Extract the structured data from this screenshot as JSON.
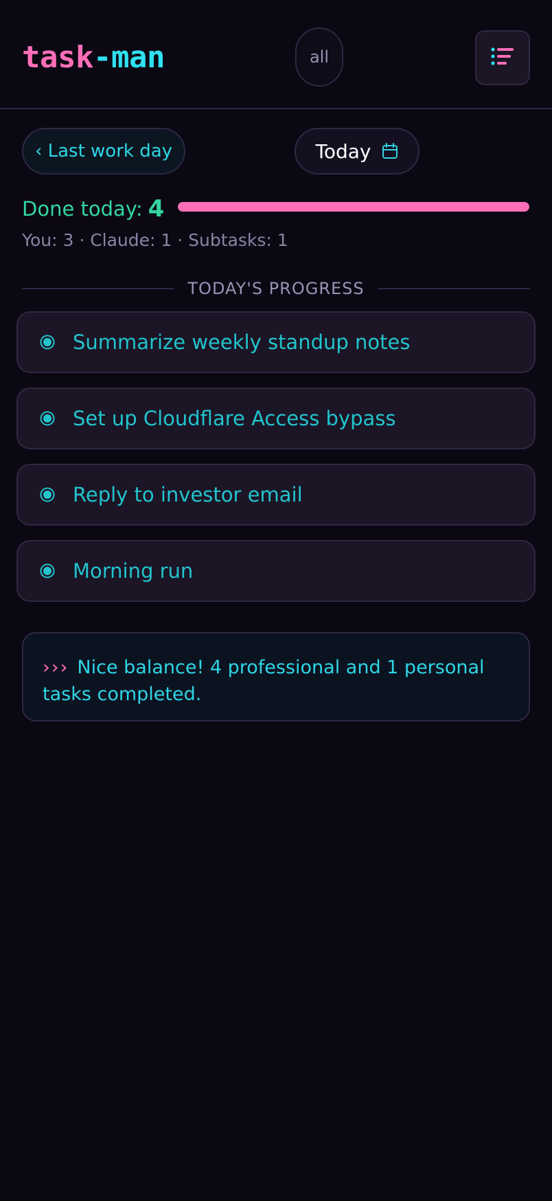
{
  "header": {
    "logo_part1": "task",
    "logo_part2": "-man",
    "filter_label": "all",
    "menu_icon": "menu-list-icon"
  },
  "nav": {
    "prev_label": "‹ Last work day",
    "today_label": "Today",
    "calendar_icon": "calendar-icon"
  },
  "summary": {
    "done_label": "Done today:",
    "done_count": "4",
    "progress_fraction": 1.0,
    "breakdown": "You: 3 · Claude: 1 · Subtasks: 1"
  },
  "section": {
    "title": "TODAY'S PROGRESS"
  },
  "tasks": [
    {
      "label": "Summarize weekly standup notes",
      "status_icon": "done-radio-icon"
    },
    {
      "label": "Set up Cloudflare Access bypass",
      "status_icon": "done-radio-icon"
    },
    {
      "label": "Reply to investor email",
      "status_icon": "done-radio-icon"
    },
    {
      "label": "Morning run",
      "status_icon": "done-radio-icon"
    }
  ],
  "insight": {
    "prefix": "›››",
    "text": "Nice balance! 4 professional and 1 personal tasks completed."
  },
  "colors": {
    "background": "#0b0813",
    "accent_pink": "#ff6fb8",
    "accent_cyan": "#2fe0f0",
    "success_green": "#34d6a0",
    "task_text": "#22c4cc"
  }
}
